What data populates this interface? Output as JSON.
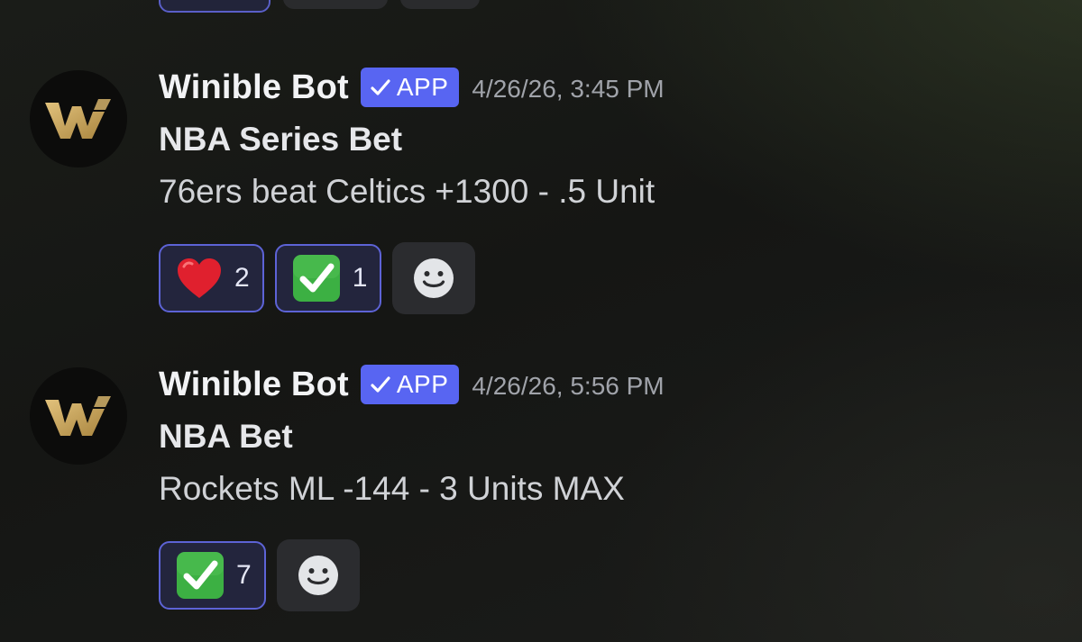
{
  "colors": {
    "app_badge": "#5865f2",
    "reaction_active_border": "#5d63d6",
    "reaction_active_bg": "#23253d",
    "add_reaction_bg": "#2b2c2f",
    "logo_gold": "#c9a865"
  },
  "messages": [
    {
      "author": "Winible Bot",
      "badge": "APP",
      "timestamp": "4/26/26, 3:45 PM",
      "title": "NBA Series Bet",
      "body": "76ers beat Celtics +1300 - .5 Unit",
      "reactions": [
        {
          "emoji": "heart-icon",
          "count": "2"
        },
        {
          "emoji": "check-mark-button-icon",
          "count": "1"
        }
      ],
      "add_reaction_icon": "smiley-add-reaction-icon"
    },
    {
      "author": "Winible Bot",
      "badge": "APP",
      "timestamp": "4/26/26, 5:56 PM",
      "title": "NBA Bet",
      "body": "Rockets ML -144 - 3 Units MAX",
      "reactions": [
        {
          "emoji": "check-mark-button-icon",
          "count": "7"
        }
      ],
      "add_reaction_icon": "smiley-add-reaction-icon"
    }
  ]
}
